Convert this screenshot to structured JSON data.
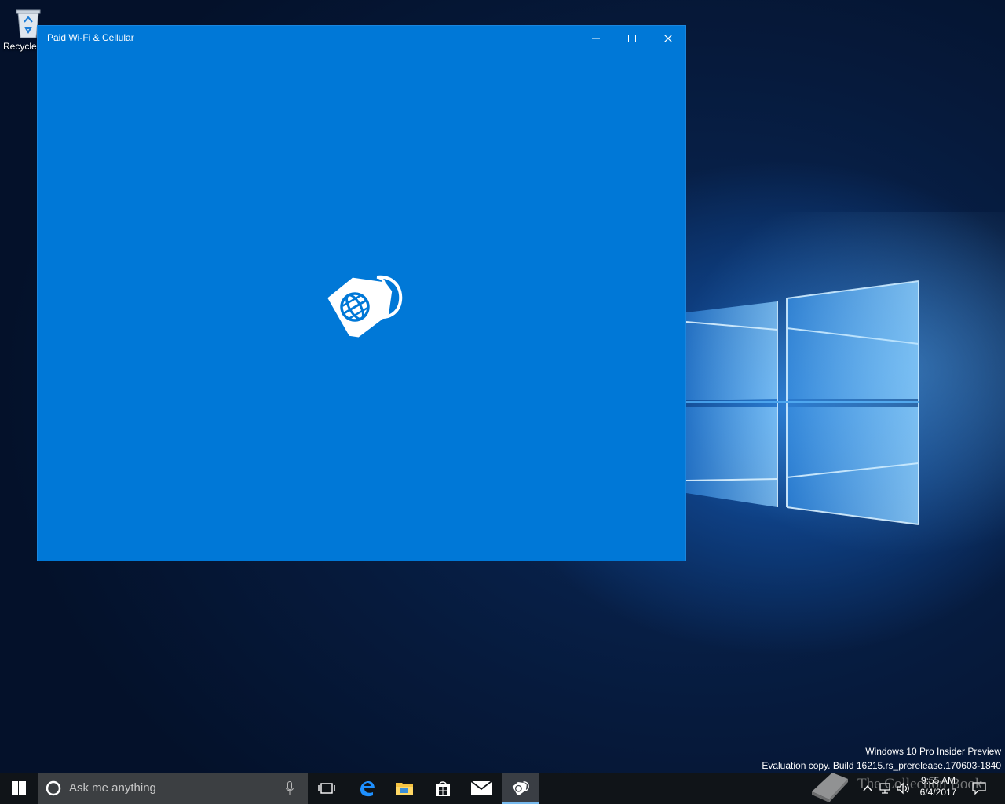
{
  "desktop": {
    "recycle_bin_label": "Recycle",
    "watermark_line1": "Windows 10 Pro Insider Preview",
    "watermark_line2": "Evaluation copy. Build 16215.rs_prerelease.170603-1840"
  },
  "window": {
    "title": "Paid Wi-Fi & Cellular",
    "background": "#0078d7",
    "splash_icon": "sim-tag-globe-icon"
  },
  "taskbar": {
    "search_placeholder": "Ask me anything",
    "clock_time": "9:55 AM",
    "clock_date": "6/4/2017",
    "accent": "#76b9ed"
  },
  "overlay": {
    "brand_text": "The Collection Book"
  }
}
